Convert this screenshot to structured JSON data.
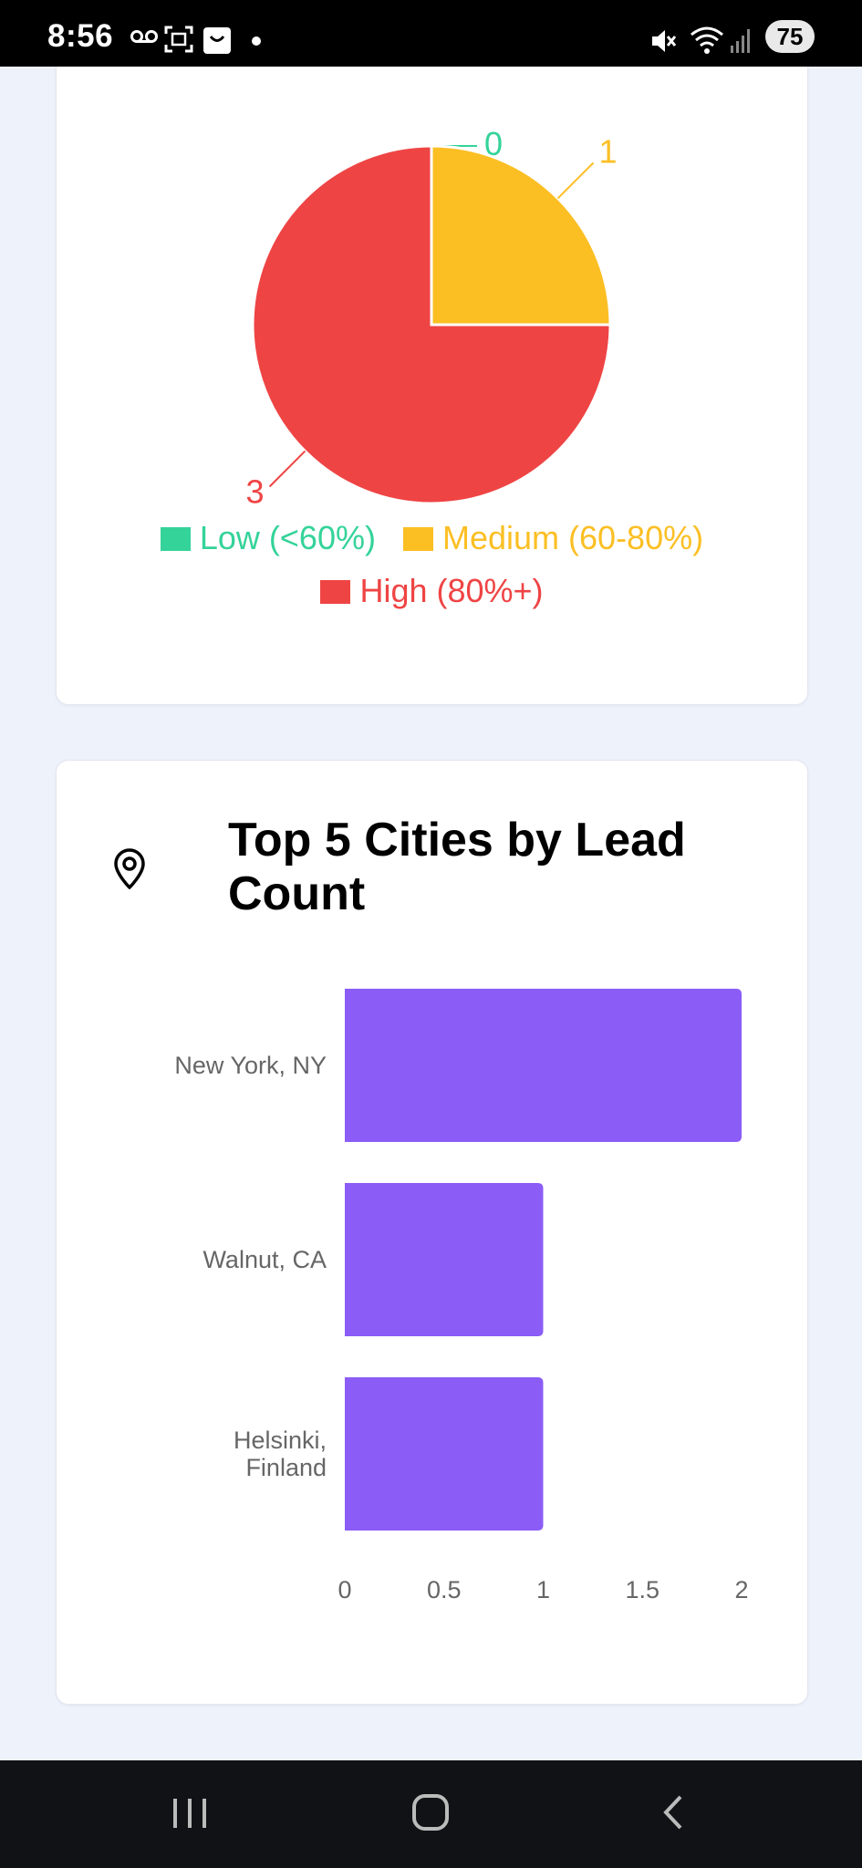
{
  "status_bar": {
    "time": "8:56",
    "battery": "75",
    "icons": [
      "voicemail-icon",
      "screenshot-icon",
      "shopping-bag-icon",
      "dot-icon",
      "mute-icon",
      "wifi-icon",
      "signal-icon"
    ]
  },
  "risk_card": {
    "legend": [
      {
        "label": "Low (<60%)",
        "color": "#34d399"
      },
      {
        "label": "Medium (60-80%)",
        "color": "#fbbf24"
      },
      {
        "label": "High (80%+)",
        "color": "#ef4444"
      }
    ]
  },
  "cities_card": {
    "icon": "map-pin-icon",
    "title": "Top 5 Cities by Lead Count"
  },
  "chart_data": [
    {
      "type": "pie",
      "categories": [
        "Low (<60%)",
        "Medium (60-80%)",
        "High (80%+)"
      ],
      "values": [
        0,
        1,
        3
      ],
      "colors": [
        "#34d399",
        "#fbbf24",
        "#ef4444"
      ],
      "data_labels": [
        "0",
        "1",
        "3"
      ],
      "legend_position": "bottom"
    },
    {
      "type": "bar",
      "orientation": "horizontal",
      "categories": [
        "New York, NY",
        "Walnut, CA",
        "Helsinki, Finland"
      ],
      "category_lines": [
        [
          "New York, NY"
        ],
        [
          "Walnut, CA"
        ],
        [
          "Helsinki,",
          "Finland"
        ]
      ],
      "values": [
        2,
        1,
        1
      ],
      "color": "#8b5cf6",
      "xlim": [
        0,
        2
      ],
      "xticks": [
        "0",
        "0.5",
        "1",
        "1.5",
        "2"
      ],
      "grid": false
    }
  ],
  "nav_bar": {
    "buttons": [
      "recents-button",
      "home-button",
      "back-button"
    ]
  }
}
